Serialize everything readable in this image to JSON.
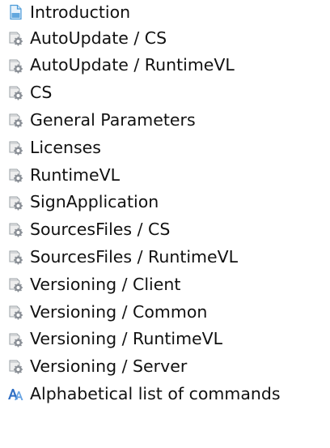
{
  "tree": {
    "items": [
      {
        "label": "Introduction",
        "icon": "document-icon"
      },
      {
        "label": "AutoUpdate / CS",
        "icon": "gear-book-icon"
      },
      {
        "label": "AutoUpdate / RuntimeVL",
        "icon": "gear-book-icon"
      },
      {
        "label": "CS",
        "icon": "gear-book-icon"
      },
      {
        "label": "General Parameters",
        "icon": "gear-book-icon"
      },
      {
        "label": "Licenses",
        "icon": "gear-book-icon"
      },
      {
        "label": "RuntimeVL",
        "icon": "gear-book-icon"
      },
      {
        "label": "SignApplication",
        "icon": "gear-book-icon"
      },
      {
        "label": "SourcesFiles / CS",
        "icon": "gear-book-icon"
      },
      {
        "label": "SourcesFiles / RuntimeVL",
        "icon": "gear-book-icon"
      },
      {
        "label": "Versioning / Client",
        "icon": "gear-book-icon"
      },
      {
        "label": "Versioning / Common",
        "icon": "gear-book-icon"
      },
      {
        "label": "Versioning / RuntimeVL",
        "icon": "gear-book-icon"
      },
      {
        "label": "Versioning / Server",
        "icon": "gear-book-icon"
      },
      {
        "label": "Alphabetical list of commands",
        "icon": "alphabetical-index-icon"
      }
    ]
  },
  "colors": {
    "text": "#111111",
    "document_blue": "#4a9ad8",
    "gear_gray": "#8a8f96",
    "index_blue": "#2f6fc4"
  }
}
